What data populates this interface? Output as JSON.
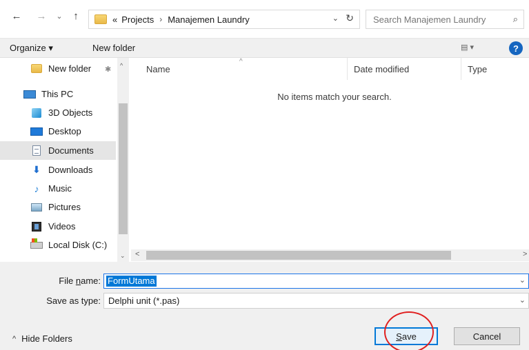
{
  "nav": {
    "back_icon": "←",
    "forward_icon": "→",
    "history_icon": "⌄",
    "up_icon": "↑"
  },
  "address": {
    "overflow": "«",
    "crumbs": [
      "Projects",
      "Manajemen Laundry"
    ],
    "separator": "›",
    "chevron_icon": "⌄",
    "refresh_icon": "↻"
  },
  "search": {
    "placeholder": "Search Manajemen Laundry",
    "icon": "⌕"
  },
  "toolbar": {
    "organize_label": "Organize ▾",
    "new_folder_label": "New folder",
    "view_icon": "▤ ▾",
    "help_icon": "?"
  },
  "sidebar": {
    "pinned_icon": "✱",
    "items": [
      {
        "label": "New folder",
        "icon": "folder-icon"
      },
      {
        "label": "This PC",
        "icon": "computer-icon"
      },
      {
        "label": "3D Objects",
        "icon": "cube-icon"
      },
      {
        "label": "Desktop",
        "icon": "desktop-icon"
      },
      {
        "label": "Documents",
        "icon": "documents-icon"
      },
      {
        "label": "Downloads",
        "icon": "download-arrow-icon"
      },
      {
        "label": "Music",
        "icon": "music-note-icon"
      },
      {
        "label": "Pictures",
        "icon": "pictures-icon"
      },
      {
        "label": "Videos",
        "icon": "video-icon"
      },
      {
        "label": "Local Disk (C:)",
        "icon": "disk-icon"
      }
    ],
    "selected_index": 4,
    "up_arrow": "^",
    "down_arrow": "⌄"
  },
  "list": {
    "columns": [
      "Name",
      "Date modified",
      "Type"
    ],
    "sort_indicator": "^",
    "empty_message": "No items match your search.",
    "left_arrow": "<",
    "right_arrow": ">"
  },
  "form": {
    "file_name_label_pre": "File ",
    "file_name_label_key": "n",
    "file_name_label_post": "ame:",
    "file_name_value": "FormUtama",
    "save_type_label": "Save as type:",
    "save_type_value": "Delphi unit (*.pas)",
    "dropdown_icon": "⌄"
  },
  "footer": {
    "hide_folders_caret": "^",
    "hide_folders_label": "Hide Folders",
    "save_key": "S",
    "save_rest": "ave",
    "cancel_label": "Cancel"
  },
  "colors": {
    "accent": "#0078d7",
    "annotation": "#e02020"
  }
}
